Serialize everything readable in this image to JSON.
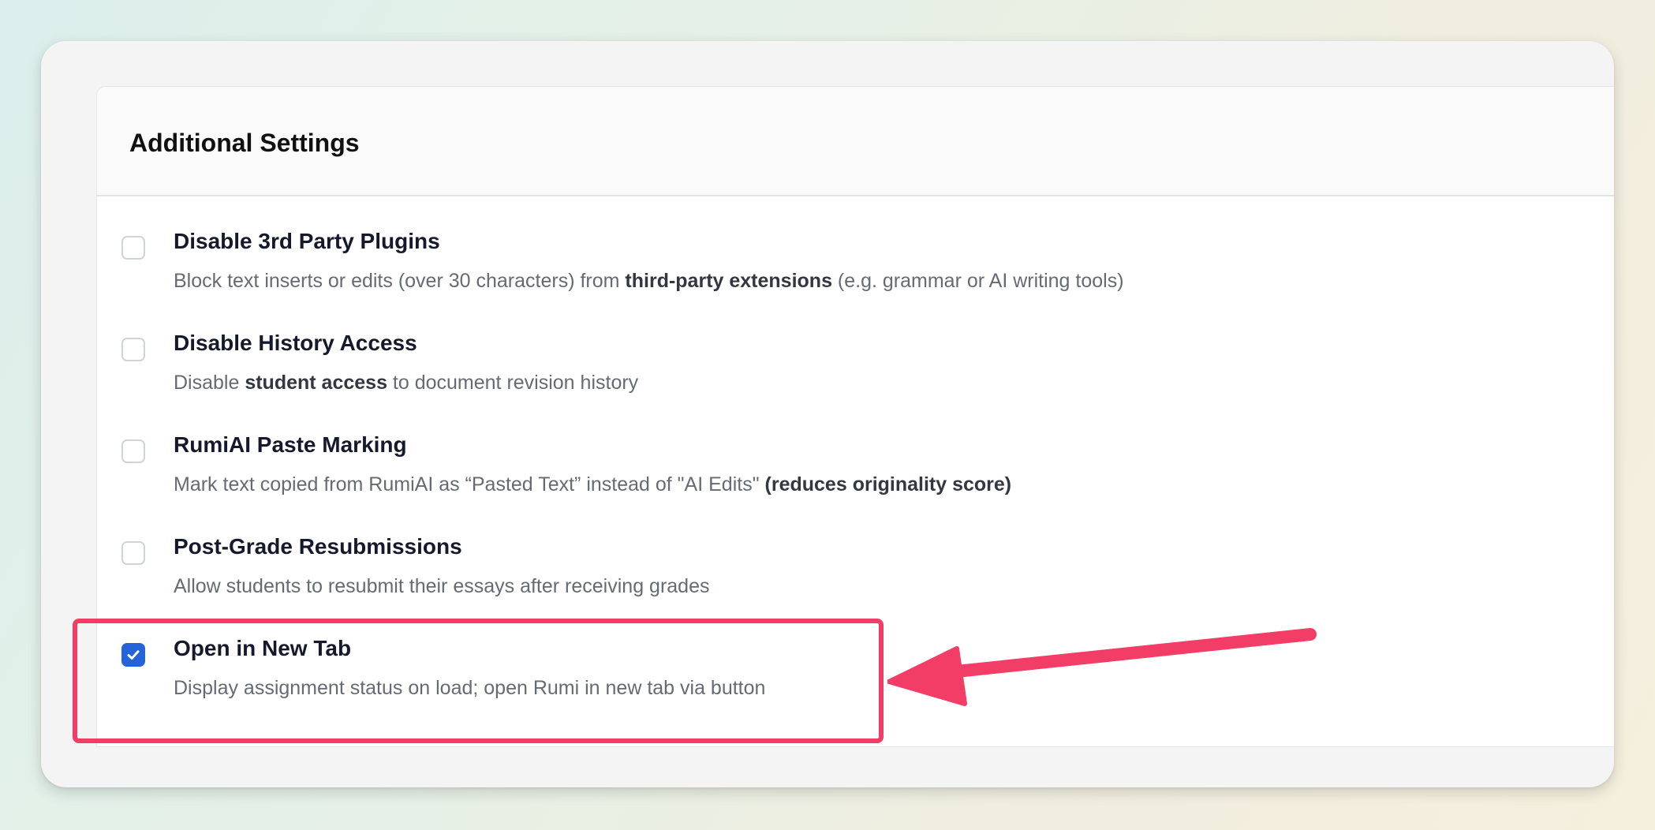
{
  "panel": {
    "title": "Additional Settings"
  },
  "settings": [
    {
      "title": "Disable 3rd Party Plugins",
      "desc_before": "Block text inserts or edits (over 30 characters) from ",
      "desc_bold": "third-party extensions",
      "desc_after": " (e.g. grammar or AI writing tools)",
      "checked": false
    },
    {
      "title": "Disable History Access",
      "desc_before": "Disable ",
      "desc_bold": "student access",
      "desc_after": " to document revision history",
      "checked": false
    },
    {
      "title": "RumiAI Paste Marking",
      "desc_before": "Mark text copied from RumiAI as “Pasted Text” instead of \"AI Edits\" ",
      "desc_bold": "(reduces originality score)",
      "desc_after": "",
      "checked": false
    },
    {
      "title": "Post-Grade Resubmissions",
      "desc_before": "Allow students to resubmit their essays after receiving grades",
      "desc_bold": "",
      "desc_after": "",
      "checked": false
    },
    {
      "title": "Open in New Tab",
      "desc_before": "Display assignment status on load; open Rumi in new tab via button",
      "desc_bold": "",
      "desc_after": "",
      "checked": true
    }
  ],
  "colors": {
    "accent": "#2563d8",
    "annotation": "#f23d66"
  },
  "icons": {
    "check": "check-icon",
    "annotation_arrow": "arrow-left-icon"
  }
}
